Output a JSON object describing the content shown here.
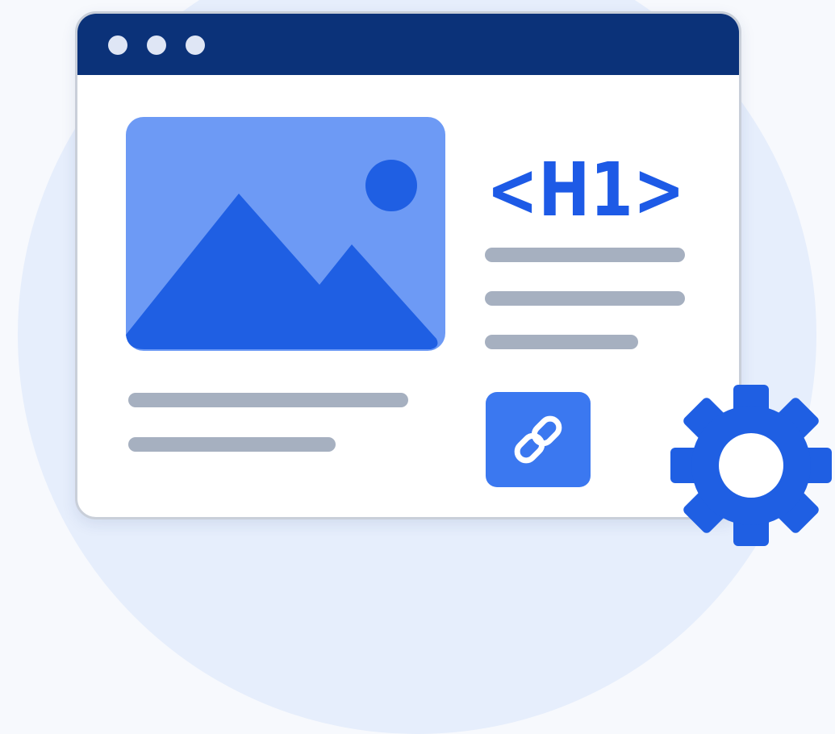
{
  "heading": {
    "tag_text": "<H1>"
  },
  "icons": {
    "image": "image-icon",
    "link": "link-icon",
    "settings": "gear-icon"
  },
  "colors": {
    "titlebar": "#0b3279",
    "accent": "#1d5ae6",
    "image_background": "#6d9af5",
    "text_placeholder": "#a6b0c0",
    "background_circle": "#e6eefc"
  }
}
